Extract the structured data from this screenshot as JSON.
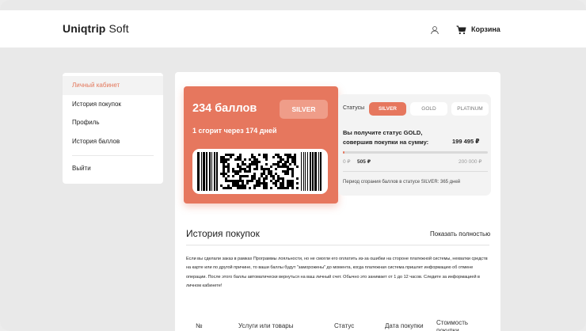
{
  "header": {
    "logo_bold": "Uniqtrip",
    "logo_light": " Soft",
    "user_icon": "user-icon",
    "cart_icon": "cart-icon",
    "cart_label": "Корзина"
  },
  "sidebar": {
    "items": [
      {
        "label": "Личный кабинет",
        "active": true
      },
      {
        "label": "История покупок"
      },
      {
        "label": "Профиль"
      },
      {
        "label": "История баллов"
      }
    ],
    "exit_label": "Выйти"
  },
  "card": {
    "points": "234 баллов",
    "badge": "SILVER",
    "burn": "1 сгорит через 174 дней",
    "color": "#e6775e"
  },
  "status": {
    "label": "Статусы",
    "tiers": [
      {
        "label": "SILVER",
        "active": true
      },
      {
        "label": "GOLD"
      },
      {
        "label": "PLATINUM"
      }
    ],
    "next_text": "Вы получите статус GOLD, совершив покупки на сумму:",
    "amount": "199 495 ₽",
    "min": "0 ₽",
    "current": "505 ₽",
    "max": "200 000 ₽",
    "progress_fraction": 0.0025,
    "period": "Период сгорания баллов в статусе SILVER: 365 дней"
  },
  "history": {
    "title": "История покупок",
    "show_all": "Показать полностью",
    "description": "Если вы сделали заказ в рамках Программы лояльности, но не смогли его оплатить из-за ошибки на стороне платежной системы, нехватки средств на карте или по другой причине, то ваши баллы будут \"заморожены\" до момента, когда платежная система пришлет информацию об отмене операции. После этого баллы автоматически вернуться на ваш личный счет. Обычно это занимает от 1 до 12 часов. Следите за информацией в личном кабинете!",
    "columns": [
      "№",
      "Услуги или товары",
      "Статус",
      "Дата покупки",
      "Стоимость покупки"
    ]
  }
}
